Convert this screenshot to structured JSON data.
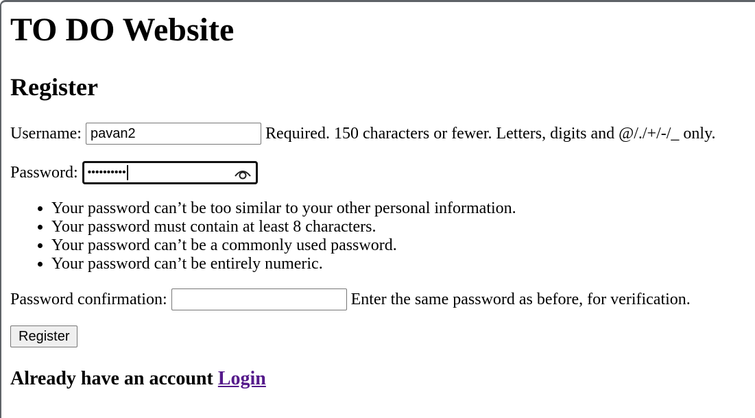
{
  "page": {
    "site_title": "TO DO Website",
    "form_title": "Register"
  },
  "username": {
    "label": "Username:",
    "value": "pavan2",
    "help": "Required. 150 characters or fewer. Letters, digits and @/./+/-/_ only."
  },
  "password": {
    "label": "Password:",
    "masked_value": "••••••••••",
    "icon": "eye-icon"
  },
  "rules": [
    "Your password can’t be too similar to your other personal information.",
    "Your password must contain at least 8 characters.",
    "Your password can’t be a commonly used password.",
    "Your password can’t be entirely numeric."
  ],
  "confirm": {
    "label": "Password confirmation:",
    "value": "",
    "help": "Enter the same password as before, for verification."
  },
  "register_button": "Register",
  "footer": {
    "prompt": "Already have an account",
    "login_link": "Login"
  },
  "colors": {
    "link_visited": "#551a8b",
    "focus_border": "#101010"
  }
}
